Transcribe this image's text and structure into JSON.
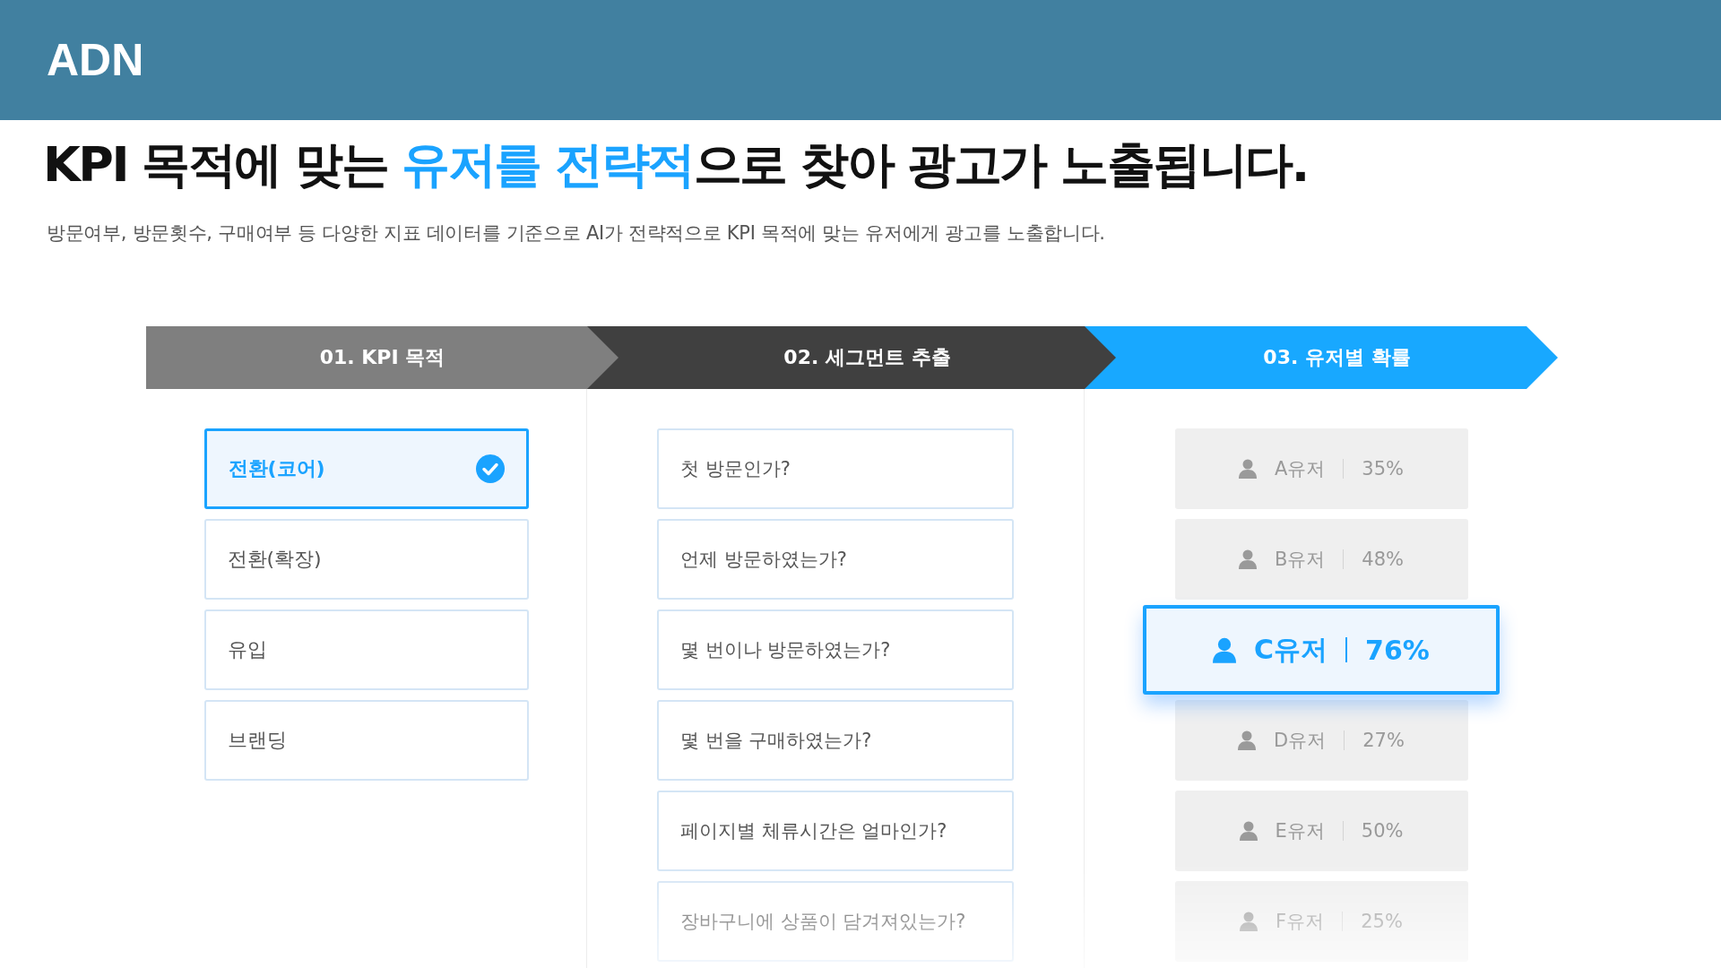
{
  "header": {
    "logo": "ADN"
  },
  "headline": [
    {
      "text": "KPI 목적에 맞는 ",
      "highlight": false
    },
    {
      "text": "유저를 전략적",
      "highlight": true
    },
    {
      "text": "으로 찾아 광고가 노출됩니다.",
      "highlight": false
    }
  ],
  "description": "방문여부, 방문횟수, 구매여부 등 다양한 지표 데이터를 기준으로 AI가 전략적으로 KPI 목적에 맞는 유저에게 광고를 노출합니다.",
  "steps": [
    {
      "label": "01. KPI 목적",
      "kind": "done"
    },
    {
      "label": "02. 세그먼트 추출",
      "kind": "middle"
    },
    {
      "label": "03. 유저별 확률",
      "kind": "current"
    }
  ],
  "kpi_options": [
    {
      "label": "전환(코어)",
      "selected": true
    },
    {
      "label": "전환(확장)",
      "selected": false
    },
    {
      "label": "유입",
      "selected": false
    },
    {
      "label": "브랜딩",
      "selected": false
    }
  ],
  "segments": [
    "첫 방문인가?",
    "언제 방문하였는가?",
    "몇 번이나 방문하였는가?",
    "몇 번을 구매하였는가?",
    "페이지별 체류시간은 얼마인가?",
    "장바구니에 상품이 담겨져있는가?"
  ],
  "users": [
    {
      "name": "A유저",
      "percent": "35%",
      "selected": false
    },
    {
      "name": "B유저",
      "percent": "48%",
      "selected": false
    },
    {
      "name": "C유저",
      "percent": "76%",
      "selected": true
    },
    {
      "name": "D유저",
      "percent": "27%",
      "selected": false
    },
    {
      "name": "E유저",
      "percent": "50%",
      "selected": false
    },
    {
      "name": "F유저",
      "percent": "25%",
      "selected": false
    }
  ]
}
